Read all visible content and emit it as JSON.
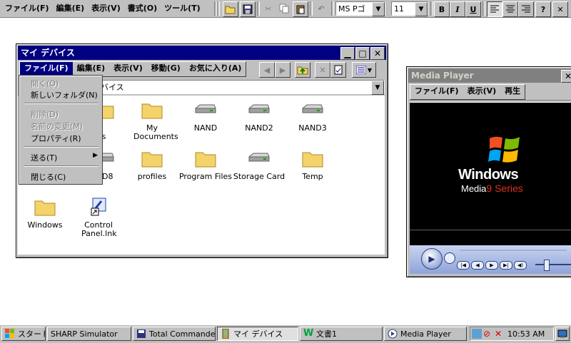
{
  "editor": {
    "menus": [
      "ファイル(F)",
      "編集(E)",
      "表示(V)",
      "書式(O)",
      "ツール(T)"
    ],
    "font_name": "MS Pゴ",
    "font_size": "11",
    "bold": "B",
    "italic": "I",
    "underline": "U",
    "help": "?"
  },
  "explorer": {
    "title": "マイ デバイス",
    "menus": [
      "ファイル(F)",
      "編集(E)",
      "表示(V)",
      "移動(G)",
      "お気に入り(A)"
    ],
    "address": "バイス",
    "file_menu": {
      "items": [
        "開く(O)",
        "新しいフォルダ(N)",
        "削除(D)",
        "名前の変更(M)",
        "プロパティ(R)",
        "送る(T)",
        "閉じる(C)"
      ]
    },
    "items": [
      {
        "label": "Documents and Settings",
        "visible": "ents\nttings",
        "icon": "folder-icon"
      },
      {
        "label": "My Documents",
        "icon": "folder-icon"
      },
      {
        "label": "NAND",
        "icon": "drive-icon"
      },
      {
        "label": "NAND2",
        "icon": "drive-icon"
      },
      {
        "label": "NAND3",
        "icon": "drive-icon"
      },
      {
        "label": "D8",
        "icon": "drive-icon"
      },
      {
        "label": "profiles",
        "icon": "folder-icon"
      },
      {
        "label": "Program Files",
        "icon": "folder-icon"
      },
      {
        "label": "Storage Card",
        "icon": "drive-icon"
      },
      {
        "label": "Temp",
        "icon": "folder-icon"
      },
      {
        "label": "Windows",
        "icon": "folder-icon"
      },
      {
        "label": "Control Panel.lnk",
        "icon": "control-panel-icon"
      }
    ]
  },
  "media_player": {
    "title": "Media Player",
    "menus": [
      "ファイル(F)",
      "表示(V)",
      "再生"
    ],
    "logo_line1": "Windows",
    "logo_line2": "Media",
    "logo_line3": "9 Series"
  },
  "taskbar": {
    "start": "スタート",
    "tasks": [
      "SHARP Simulator",
      "Total Commande...",
      "マイ デバイス",
      "文書1",
      "Media Player"
    ],
    "clock": "10:53 AM"
  },
  "colors": {
    "titlebar_active": "#000080",
    "titlebar_inactive": "#808080",
    "chrome": "#c0c0c0",
    "folder": "#f4d36a"
  }
}
